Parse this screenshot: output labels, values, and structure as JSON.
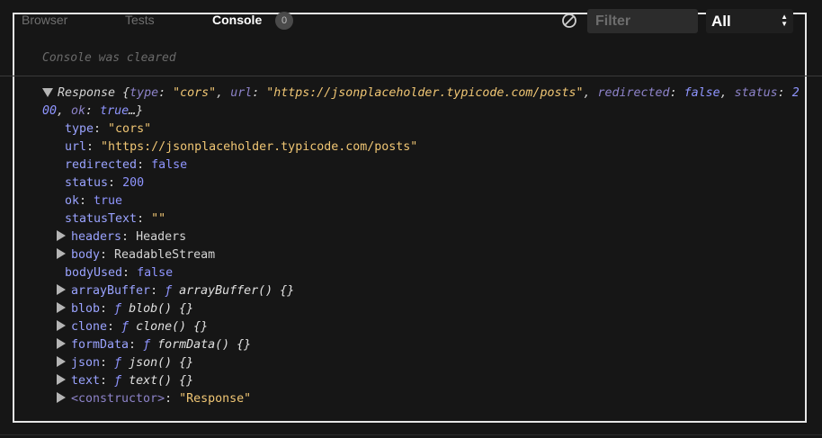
{
  "tabs": [
    {
      "label": "Browser"
    },
    {
      "label": "Tests"
    },
    {
      "label": "Console"
    }
  ],
  "console_count": "0",
  "filter": {
    "placeholder": "Filter",
    "level": "All"
  },
  "icons": {
    "clear": "block-icon",
    "expand": "triangle-right-icon",
    "collapse": "triangle-down-icon"
  },
  "log": {
    "cleared_message": "Console was cleared",
    "response_name": "Response",
    "summary_open": "{",
    "summary_type_key": "type",
    "summary_type_val": "\"cors\"",
    "summary_url_key": "url",
    "summary_url_val": "\"https://jsonplaceholder.typicode.com/posts\"",
    "summary_redirected_key": "redirected",
    "summary_redirected_val": "false",
    "summary_status_key": "status",
    "summary_status_val_part1": "2",
    "summary_status_val_part2": "00",
    "summary_ok_key": "ok",
    "summary_ok_val": "true",
    "summary_close": "…}",
    "props": [
      {
        "key": "type",
        "value": "\"cors\""
      },
      {
        "key": "url",
        "value": "\"https://jsonplaceholder.typicode.com/posts\""
      },
      {
        "key": "redirected",
        "value": "false"
      },
      {
        "key": "status",
        "value": "200"
      },
      {
        "key": "ok",
        "value": "true"
      },
      {
        "key": "statusText",
        "value": "\"\""
      },
      {
        "key": "headers",
        "value": "Headers"
      },
      {
        "key": "body",
        "value": "ReadableStream"
      },
      {
        "key": "bodyUsed",
        "value": "false"
      },
      {
        "key": "arrayBuffer",
        "fsym": "ƒ",
        "value": "arrayBuffer() {}"
      },
      {
        "key": "blob",
        "fsym": "ƒ",
        "value": "blob() {}"
      },
      {
        "key": "clone",
        "fsym": "ƒ",
        "value": "clone() {}"
      },
      {
        "key": "formData",
        "fsym": "ƒ",
        "value": "formData() {}"
      },
      {
        "key": "json",
        "fsym": "ƒ",
        "value": "json() {}"
      },
      {
        "key": "text",
        "fsym": "ƒ",
        "value": "text() {}"
      },
      {
        "key": "<constructor>",
        "value": "\"Response\""
      }
    ]
  }
}
